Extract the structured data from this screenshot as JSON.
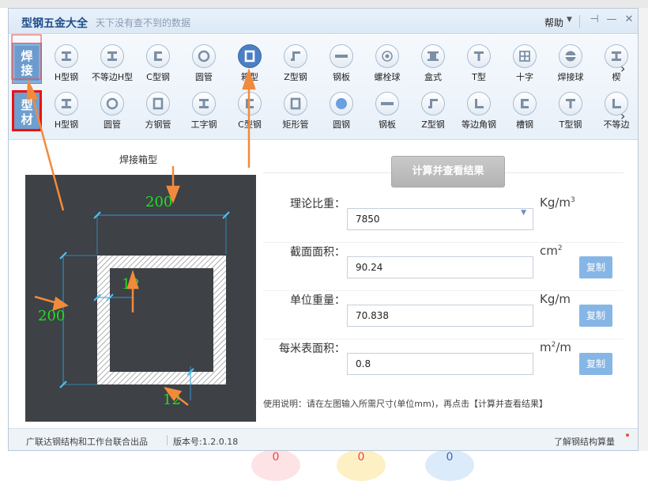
{
  "window": {
    "title": "型钢五金大全",
    "slogan": "天下没有查不到的数据",
    "help_label": "帮助",
    "help_arrow": "▼",
    "pin": "⊣",
    "minimize": "—",
    "close": "✕"
  },
  "categories": {
    "weld_line1": "焊",
    "weld_line2": "接",
    "profile_line1": "型",
    "profile_line2": "材"
  },
  "row_weld": [
    {
      "label": "H型钢",
      "glyph": "I"
    },
    {
      "label": "不等边H型",
      "glyph": "I"
    },
    {
      "label": "C型钢",
      "glyph": "C"
    },
    {
      "label": "圆管",
      "glyph": "O"
    },
    {
      "label": "箱型",
      "glyph": "box",
      "selected": true
    },
    {
      "label": "Z型钢",
      "glyph": "Z"
    },
    {
      "label": "钢板",
      "glyph": "plate"
    },
    {
      "label": "螺栓球",
      "glyph": "ball"
    },
    {
      "label": "盒式",
      "glyph": "II"
    },
    {
      "label": "T型",
      "glyph": "T"
    },
    {
      "label": "十字",
      "glyph": "cross"
    },
    {
      "label": "焊接球",
      "glyph": "ball2"
    },
    {
      "label": "楔",
      "glyph": "I"
    }
  ],
  "row_profile": [
    {
      "label": "H型钢",
      "glyph": "I"
    },
    {
      "label": "圆管",
      "glyph": "O"
    },
    {
      "label": "方钢管",
      "glyph": "box"
    },
    {
      "label": "工字钢",
      "glyph": "I"
    },
    {
      "label": "C型钢",
      "glyph": "C"
    },
    {
      "label": "矩形管",
      "glyph": "box"
    },
    {
      "label": "圆钢",
      "glyph": "disc"
    },
    {
      "label": "钢板",
      "glyph": "plate"
    },
    {
      "label": "Z型钢",
      "glyph": "Z"
    },
    {
      "label": "等边角钢",
      "glyph": "L"
    },
    {
      "label": "槽钢",
      "glyph": "C"
    },
    {
      "label": "T型钢",
      "glyph": "T"
    },
    {
      "label": "不等边",
      "glyph": "L"
    }
  ],
  "row_more": "›",
  "diagram": {
    "title": "焊接箱型",
    "width": "200",
    "height": "200",
    "web_thickness": "12",
    "flange_thickness": "12"
  },
  "calc_button": "计算并查看结果",
  "fields": [
    {
      "label": "理论比重：",
      "value": "7850",
      "unit": "Kg/m",
      "unit_sup": "3",
      "dropdown": true
    },
    {
      "label": "截面面积：",
      "value": "90.24",
      "unit": "cm",
      "unit_sup": "2",
      "copy": "复制"
    },
    {
      "label": "单位重量：",
      "value": "70.838",
      "unit": "Kg/m",
      "unit_sup": "",
      "copy": "复制"
    },
    {
      "label": "每米表面积：",
      "value": "0.8",
      "unit": "m",
      "unit_sup": "2",
      "unit_suffix": "/m",
      "copy": "复制"
    }
  ],
  "usage": "使用说明：请在左图输入所需尺寸(单位mm)，再点击【计算并查看结果】",
  "status": {
    "credit": "广联达钢结构和工作台联合出品",
    "version": "版本号:1.2.0.18",
    "link": "了解钢结构算量"
  },
  "background_circles": [
    "0",
    "0",
    "0"
  ],
  "colors": {
    "accent": "#4b7fc4",
    "annotation": "#f28a3c",
    "highlight": "#ee1111",
    "dimension_text": "#22dd22",
    "canvas": "#3e4146"
  }
}
